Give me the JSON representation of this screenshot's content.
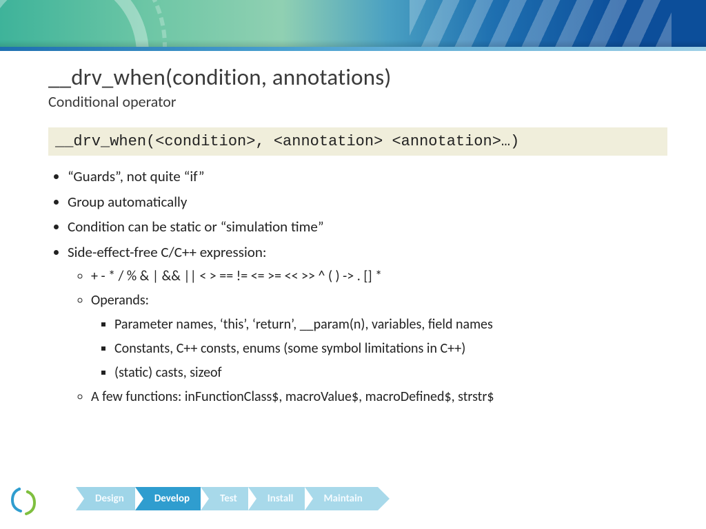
{
  "title": "__drv_when(condition, annotations)",
  "subtitle": "Conditional operator",
  "code": "__drv_when(<condition>, <annotation> <annotation>…)",
  "bullets": {
    "b1": "“Guards”, not quite “if”",
    "b2": "Group automatically",
    "b3": "Condition can be static or “simulation time”",
    "b4": "Side-effect-free C/C++ expression:",
    "b4_s1": "+ - * / % & | && || < > == != <= >= << >> ^ ( ) -> . [] *",
    "b4_s2": "Operands:",
    "b4_s2_a": "Parameter names, ‘this’, ‘return’, __param(n), variables, field names",
    "b4_s2_b": "Constants, C++ consts, enums (some symbol limitations in C++)",
    "b4_s2_c": "(static) casts, sizeof",
    "b4_s3": "A few functions: inFunctionClass$, macroValue$, macroDefined$, strstr$"
  },
  "lifecycle": {
    "a1": "Design",
    "a2": "Develop",
    "a3": "Test",
    "a4": "Install",
    "a5": "Maintain"
  }
}
